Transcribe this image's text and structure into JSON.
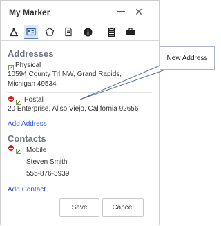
{
  "window": {
    "title": "My Marker",
    "minimize_icon": "minimize-icon",
    "close_icon": "close-icon",
    "close_glyph": "✕"
  },
  "toolbar": {
    "tools": [
      {
        "name": "style",
        "icon": "marker-style-icon"
      },
      {
        "name": "details",
        "icon": "id-card-icon",
        "active": true
      },
      {
        "name": "shape",
        "icon": "pentagon-icon"
      },
      {
        "name": "notes",
        "icon": "edit-note-icon"
      },
      {
        "name": "info",
        "icon": "info-icon"
      },
      {
        "name": "clipboard",
        "icon": "clipboard-icon"
      },
      {
        "name": "briefcase",
        "icon": "briefcase-icon"
      }
    ]
  },
  "addresses": {
    "heading": "Addresses",
    "items": [
      {
        "type": "Physical",
        "line1": "10594 County Trl NW, Grand Rapids,",
        "line2": "Michigan 49534"
      },
      {
        "type": "Postal",
        "line1": "20 Enterprise, Aliso Viejo, California 92656",
        "line2": ""
      }
    ],
    "add_link": "Add Address"
  },
  "contacts": {
    "heading": "Contacts",
    "items": [
      {
        "type": "Mobile",
        "name": "Steven Smith",
        "phone": "555-876-3939"
      }
    ],
    "add_link": "Add Contact"
  },
  "buttons": {
    "save": "Save",
    "cancel": "Cancel"
  },
  "callout": {
    "text": "New Address"
  },
  "colors": {
    "heading": "#6b7286",
    "link": "#2a54d6",
    "delete": "#d81d1d",
    "active_tab": "#dde6f2"
  }
}
